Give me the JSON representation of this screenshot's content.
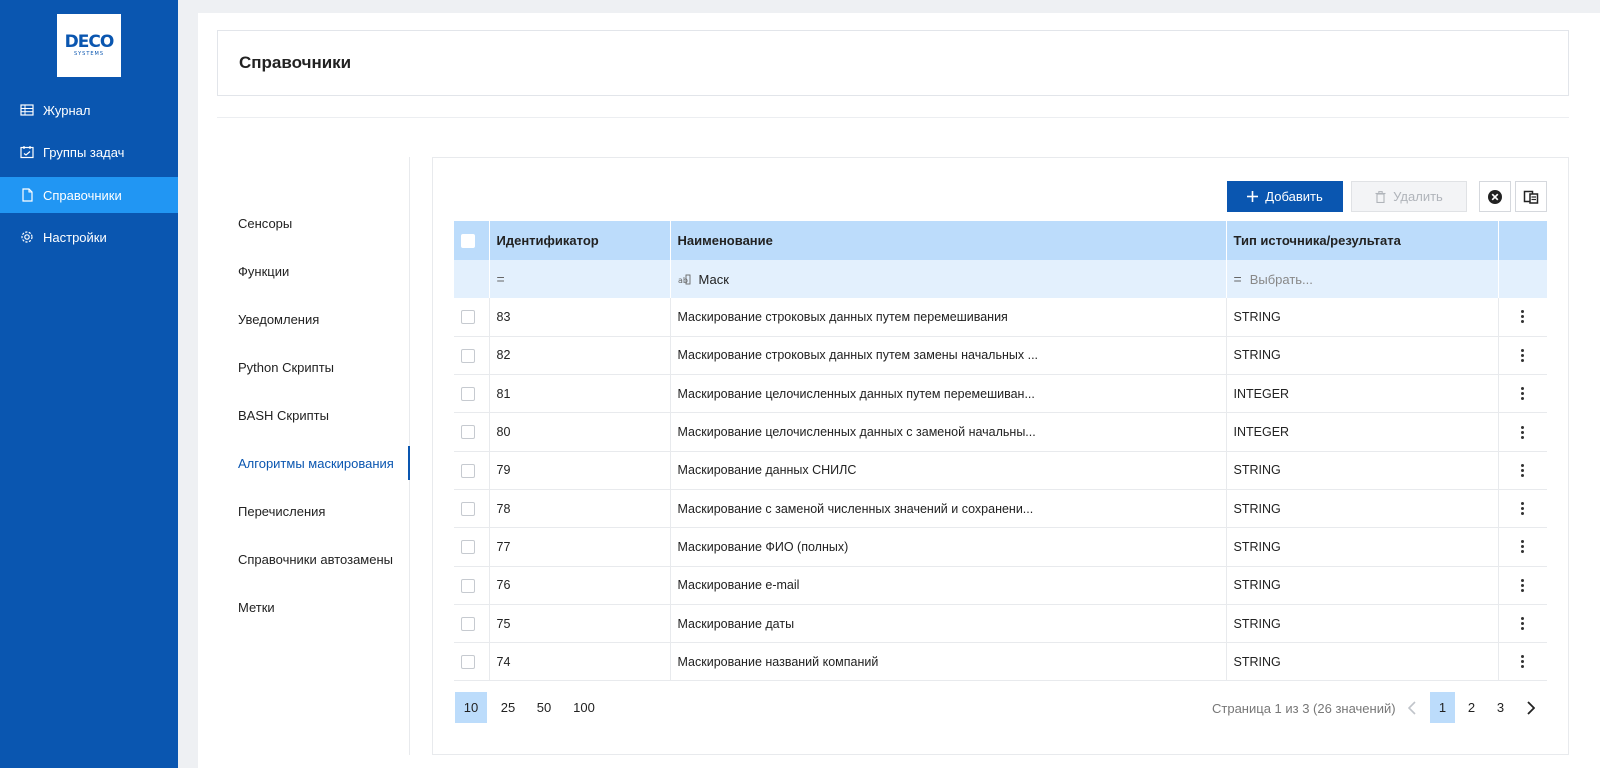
{
  "logo": {
    "main": "DECO",
    "sub": "SYSTEMS"
  },
  "sidebar": {
    "items": [
      {
        "label": "Журнал",
        "icon": "table-icon"
      },
      {
        "label": "Группы задач",
        "icon": "tasks-icon"
      },
      {
        "label": "Справочники",
        "icon": "document-icon",
        "active": true
      },
      {
        "label": "Настройки",
        "icon": "gear-icon"
      }
    ]
  },
  "header": {
    "title": "Справочники"
  },
  "subnav": {
    "items": [
      {
        "label": "Сенсоры"
      },
      {
        "label": "Функции"
      },
      {
        "label": "Уведомления"
      },
      {
        "label": "Python Скрипты"
      },
      {
        "label": "BASH Скрипты"
      },
      {
        "label": "Алгоритмы маскирования",
        "active": true
      },
      {
        "label": "Перечисления"
      },
      {
        "label": "Справочники автозамены"
      },
      {
        "label": "Метки"
      }
    ]
  },
  "toolbar": {
    "add_label": "Добавить",
    "delete_label": "Удалить"
  },
  "table": {
    "columns": [
      "Идентификатор",
      "Наименование",
      "Тип источника/результата"
    ],
    "filters": {
      "name_value": "Маск",
      "type_placeholder": "Выбрать..."
    },
    "rows": [
      {
        "id": "83",
        "name": "Маскирование строковых данных путем перемешивания",
        "type": "STRING"
      },
      {
        "id": "82",
        "name": "Маскирование строковых данных путем замены начальных ...",
        "type": "STRING"
      },
      {
        "id": "81",
        "name": "Маскирование целочисленных данных путем перемешиван...",
        "type": "INTEGER"
      },
      {
        "id": "80",
        "name": "Маскирование целочисленных данных с заменой начальны...",
        "type": "INTEGER"
      },
      {
        "id": "79",
        "name": "Маскирование данных СНИЛС",
        "type": "STRING"
      },
      {
        "id": "78",
        "name": "Маскирование с заменой численных значений и сохранени...",
        "type": "STRING"
      },
      {
        "id": "77",
        "name": "Маскирование ФИО (полных)",
        "type": "STRING"
      },
      {
        "id": "76",
        "name": "Маскирование e-mail",
        "type": "STRING"
      },
      {
        "id": "75",
        "name": "Маскирование даты",
        "type": "STRING"
      },
      {
        "id": "74",
        "name": "Маскирование названий компаний",
        "type": "STRING"
      }
    ]
  },
  "pagination": {
    "page_sizes": [
      "10",
      "25",
      "50",
      "100"
    ],
    "selected_size": "10",
    "info": "Страница 1 из 3 (26 значений)",
    "pages": [
      "1",
      "2",
      "3"
    ],
    "current_page": "1"
  },
  "colors": {
    "brand": "#0a56b0",
    "active_nav": "#2196f3",
    "table_header": "#bcdcfb"
  }
}
